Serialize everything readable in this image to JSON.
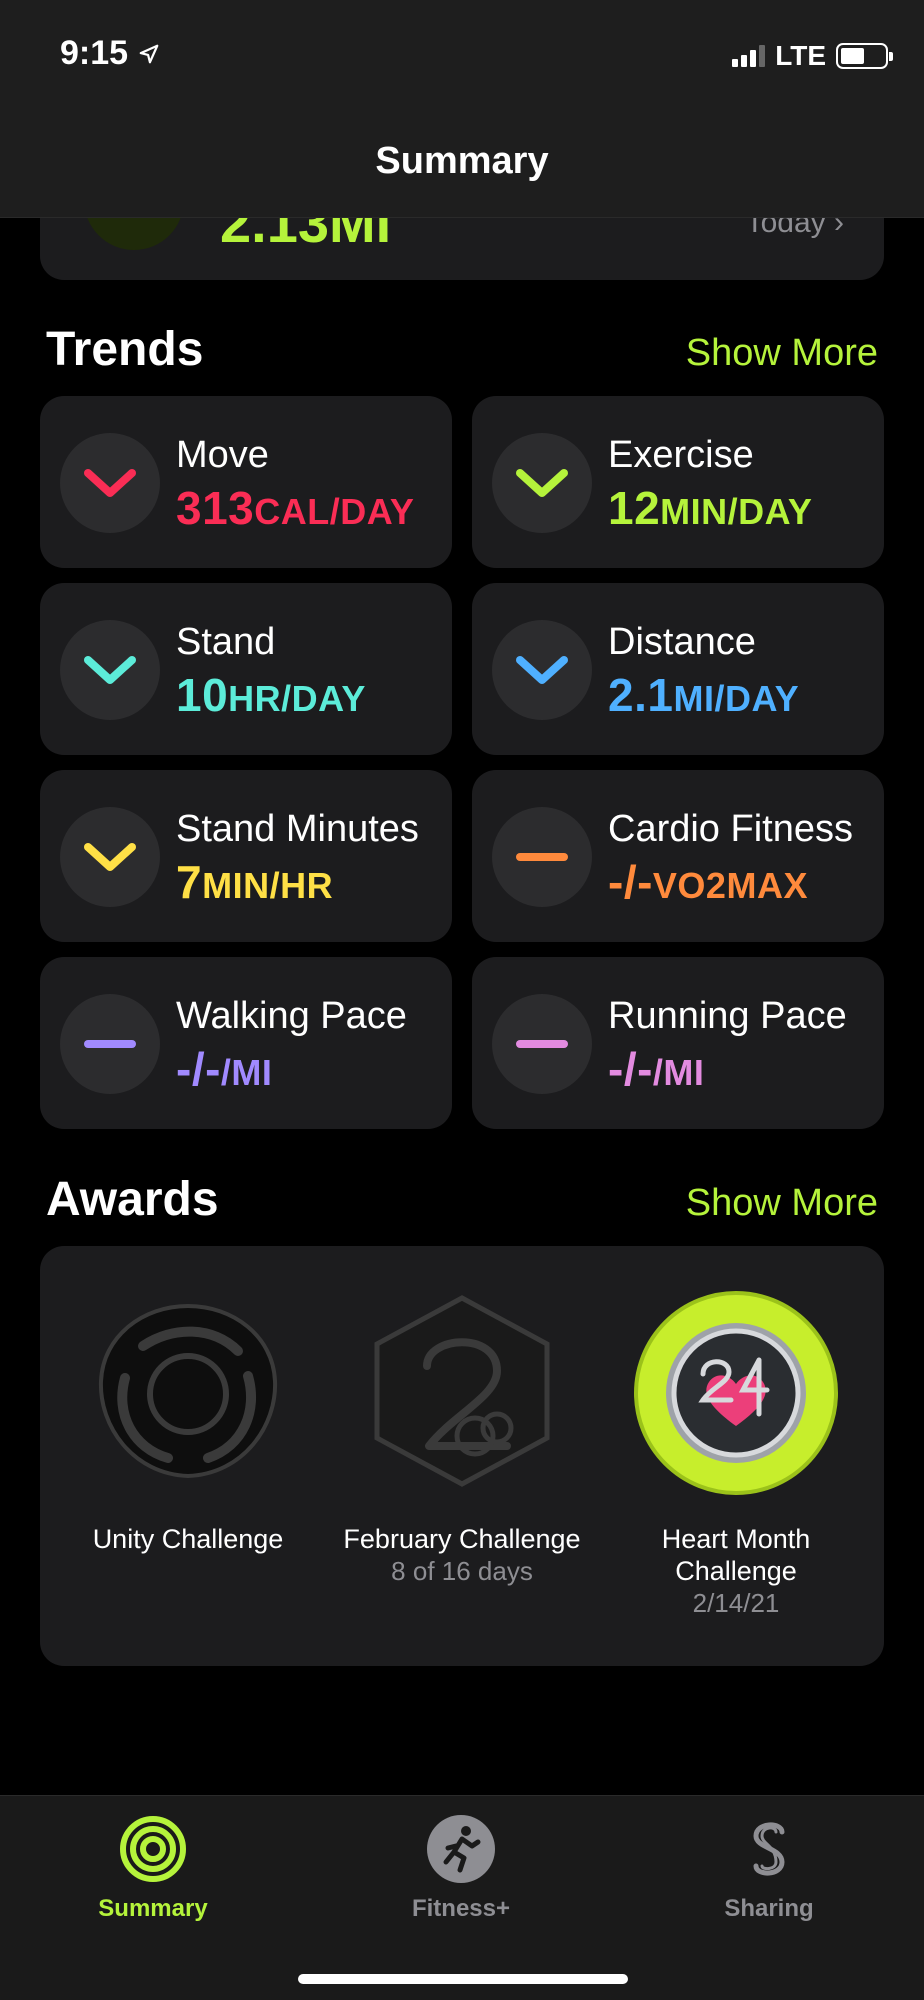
{
  "status_bar": {
    "time": "9:15",
    "network": "LTE"
  },
  "nav": {
    "title": "Summary"
  },
  "peek": {
    "value": "2.13MI",
    "date_label": "Today"
  },
  "trends": {
    "title": "Trends",
    "show_more": "Show More",
    "items": [
      {
        "label": "Move",
        "num": "313",
        "unit": "CAL/DAY",
        "direction": "down",
        "color": "#fa2d55"
      },
      {
        "label": "Exercise",
        "num": "12",
        "unit": "MIN/DAY",
        "direction": "down",
        "color": "#b5f33b"
      },
      {
        "label": "Stand",
        "num": "10",
        "unit": "HR/DAY",
        "direction": "down",
        "color": "#5cecd9"
      },
      {
        "label": "Distance",
        "num": "2.1",
        "unit": "MI/DAY",
        "direction": "down",
        "color": "#4fb0ff"
      },
      {
        "label": "Stand Minutes",
        "num": "7",
        "unit": "MIN/HR",
        "direction": "down",
        "color": "#ffe046"
      },
      {
        "label": "Cardio Fitness",
        "num": "-/-",
        "unit": "VO2MAX",
        "direction": "flat",
        "color": "#ff8a3c"
      },
      {
        "label": "Walking Pace",
        "num": "-/-",
        "unit": "/MI",
        "direction": "flat",
        "color": "#a18aff"
      },
      {
        "label": "Running Pace",
        "num": "-/-",
        "unit": "/MI",
        "direction": "flat",
        "color": "#e38be0"
      }
    ]
  },
  "awards": {
    "title": "Awards",
    "show_more": "Show More",
    "items": [
      {
        "name": "Unity Challenge",
        "sub": ""
      },
      {
        "name": "February Challenge",
        "sub": "8 of 16 days"
      },
      {
        "name": "Heart Month Challenge",
        "sub": "2/14/21"
      }
    ]
  },
  "tabs": [
    {
      "label": "Summary",
      "active": true,
      "color": "#b5f33b"
    },
    {
      "label": "Fitness+",
      "active": false,
      "color": "#8e8e93"
    },
    {
      "label": "Sharing",
      "active": false,
      "color": "#8e8e93"
    }
  ]
}
